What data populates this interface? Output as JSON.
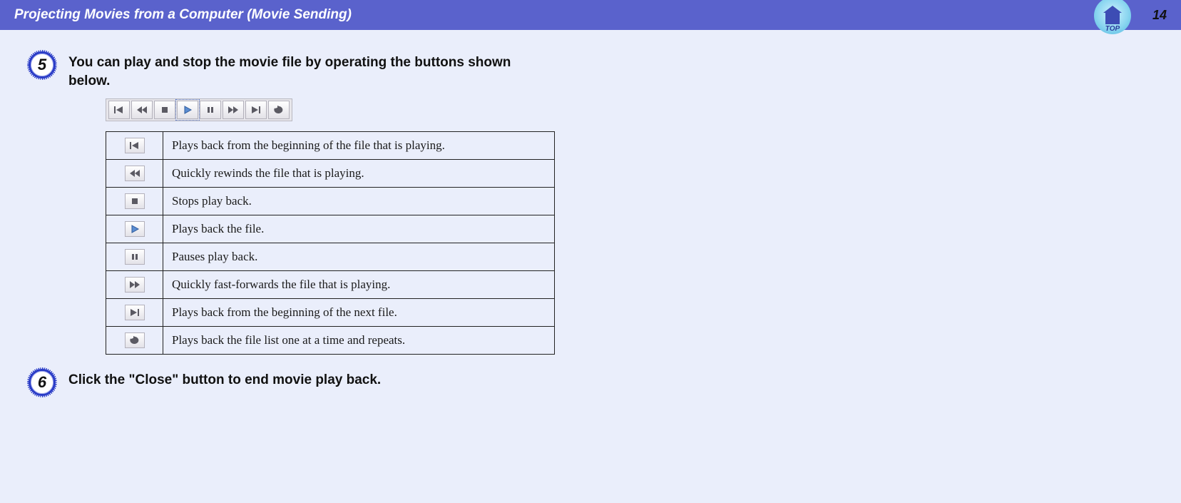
{
  "header": {
    "title": "Projecting Movies from a Computer (Movie Sending)",
    "page_number": "14",
    "top_label": "TOP"
  },
  "steps": [
    {
      "num": "5",
      "text": "You can play and stop the movie file by operating the buttons shown below."
    },
    {
      "num": "6",
      "text": "Click the \"Close\" button to end movie play back."
    }
  ],
  "toolbar": [
    {
      "id": "skip-back",
      "icon": "skip-back"
    },
    {
      "id": "rewind",
      "icon": "rewind"
    },
    {
      "id": "stop",
      "icon": "stop"
    },
    {
      "id": "play",
      "icon": "play",
      "selected": true,
      "accent": true
    },
    {
      "id": "pause",
      "icon": "pause"
    },
    {
      "id": "fast-forward",
      "icon": "fast-forward"
    },
    {
      "id": "skip-forward",
      "icon": "skip-forward"
    },
    {
      "id": "repeat",
      "icon": "repeat"
    }
  ],
  "table": [
    {
      "icon": "skip-back",
      "desc": "Plays back from the beginning of the file that is playing."
    },
    {
      "icon": "rewind",
      "desc": "Quickly rewinds the file that is playing."
    },
    {
      "icon": "stop",
      "desc": "Stops play back."
    },
    {
      "icon": "play",
      "desc": "Plays back the file.",
      "accent": true
    },
    {
      "icon": "pause",
      "desc": "Pauses play back."
    },
    {
      "icon": "fast-forward",
      "desc": "Quickly fast-forwards the file that is playing."
    },
    {
      "icon": "skip-forward",
      "desc": "Plays back from the beginning of the next file."
    },
    {
      "icon": "repeat",
      "desc": "Plays back the file list one at a time and repeats."
    }
  ]
}
